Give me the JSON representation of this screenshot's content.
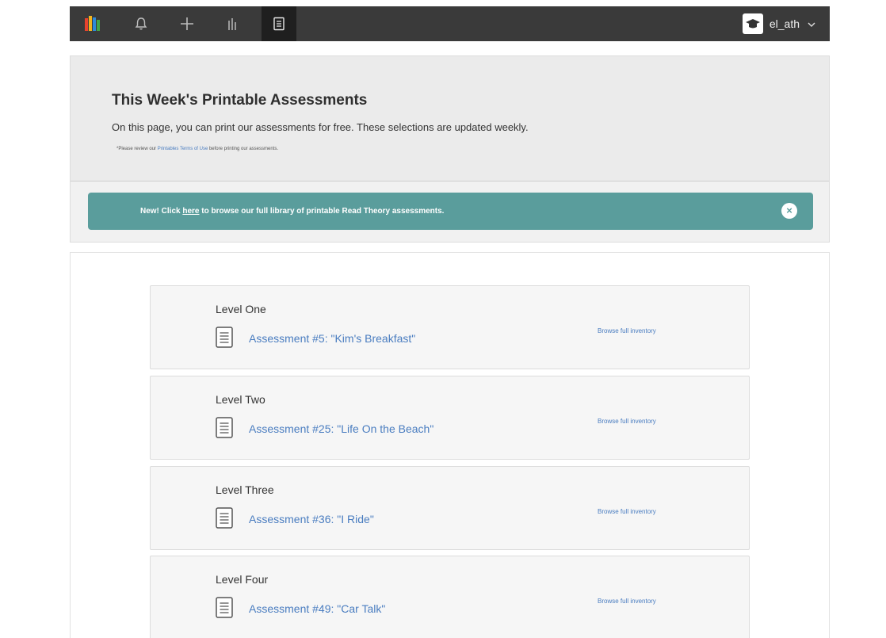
{
  "nav": {
    "items": [
      "logo",
      "notifications",
      "add",
      "reports",
      "printables"
    ],
    "active": "printables",
    "user_name": "el_ath"
  },
  "header": {
    "title": "This Week's Printable Assessments",
    "description": "On this page, you can print our assessments for free. These selections are updated weekly.",
    "terms_prefix": "*Please review our ",
    "terms_link": "Printables Terms of Use",
    "terms_suffix": " before printing our assessments."
  },
  "banner": {
    "prefix": "New! Click ",
    "link": "here",
    "suffix": " to browse our full library of printable Read Theory assessments.",
    "close_label": "×"
  },
  "levels": [
    {
      "name": "Level One",
      "assessment": "Assessment #5: \"Kim's Breakfast\"",
      "browse": "Browse full inventory"
    },
    {
      "name": "Level Two",
      "assessment": "Assessment #25: \"Life On the Beach\"",
      "browse": "Browse full inventory"
    },
    {
      "name": "Level Three",
      "assessment": "Assessment #36: \"I Ride\"",
      "browse": "Browse full inventory"
    },
    {
      "name": "Level Four",
      "assessment": "Assessment #49: \"Car Talk\"",
      "browse": "Browse full inventory"
    }
  ],
  "colors": {
    "topbar": "#3a3a3a",
    "banner": "#5a9d9c",
    "link": "#4a7dc0"
  },
  "icons": [
    "logo-icon",
    "bell-icon",
    "plus-icon",
    "bar-chart-icon",
    "document-icon",
    "graduation-cap-icon",
    "chevron-down-icon",
    "close-icon"
  ]
}
